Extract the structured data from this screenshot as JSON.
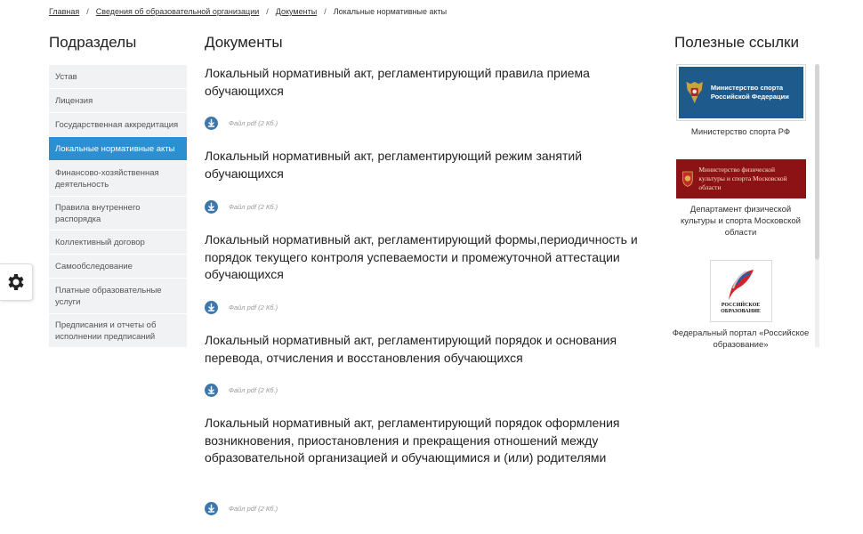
{
  "breadcrumb": {
    "items": [
      "Главная",
      "Сведения об образовательной организации",
      "Документы"
    ],
    "current": "Локальные нормативные акты"
  },
  "sidebar": {
    "title": "Подразделы",
    "items": [
      {
        "label": "Устав"
      },
      {
        "label": "Лицензия"
      },
      {
        "label": "Государственная аккредитация"
      },
      {
        "label": "Локальные нормативные акты",
        "active": true
      },
      {
        "label": "Финансово-хозяйственная деятельность"
      },
      {
        "label": "Правила внутреннего распорядка"
      },
      {
        "label": "Коллективный договор"
      },
      {
        "label": "Самообследование"
      },
      {
        "label": "Платные образовательные услуги"
      },
      {
        "label": "Предписания и отчеты об исполнении предписаний"
      }
    ]
  },
  "documents": {
    "title": "Документы",
    "items": [
      {
        "title": "Локальный нормативный акт, регламентирующий правила приема обучающихся",
        "file": "Файл pdf (2 Кб.)"
      },
      {
        "title": "Локальный нормативный акт, регламентирующий режим занятий обучающихся",
        "file": "Файл pdf (2 Кб.)"
      },
      {
        "title": "Локальный нормативный акт, регламентирующий формы,периодичность и порядок текущего контроля успеваемости и промежуточной аттестации обучающихся",
        "file": "Файл pdf (2 Кб.)"
      },
      {
        "title": "Локальный нормативный акт, регламентирующий порядок и основания перевода, отчисления и восстановления обучающихся",
        "file": "Файл pdf (2 Кб.)"
      },
      {
        "title": "Локальный нормативный акт, регламентирующий порядок оформления возникновения, приостановления и прекращения отношений между образовательной организацией и обучающимися и (или) родителями",
        "file": "Файл pdf (2 Кб.)"
      }
    ]
  },
  "links": {
    "title": "Полезные ссылки",
    "items": [
      {
        "logo_text": "Министерство спорта Российской Федерации",
        "caption": "Министерство спорта РФ"
      },
      {
        "logo_text": "Министерство физической культуры и спорта Московской области",
        "caption": "Департамент физической культуры и спорта Московской области"
      },
      {
        "logo_text": "РОССИЙСКОЕ ОБРАЗОВАНИЕ",
        "caption": "Федеральный портал «Российское образование»"
      }
    ]
  },
  "colors": {
    "accent": "#2b8fd1",
    "download_icon": "#3d78ad",
    "minsport_bg": "#1e5b8c",
    "mosobl_bg": "#8d1215"
  },
  "icons": {
    "download": "download-icon",
    "settings": "gear-icon"
  }
}
